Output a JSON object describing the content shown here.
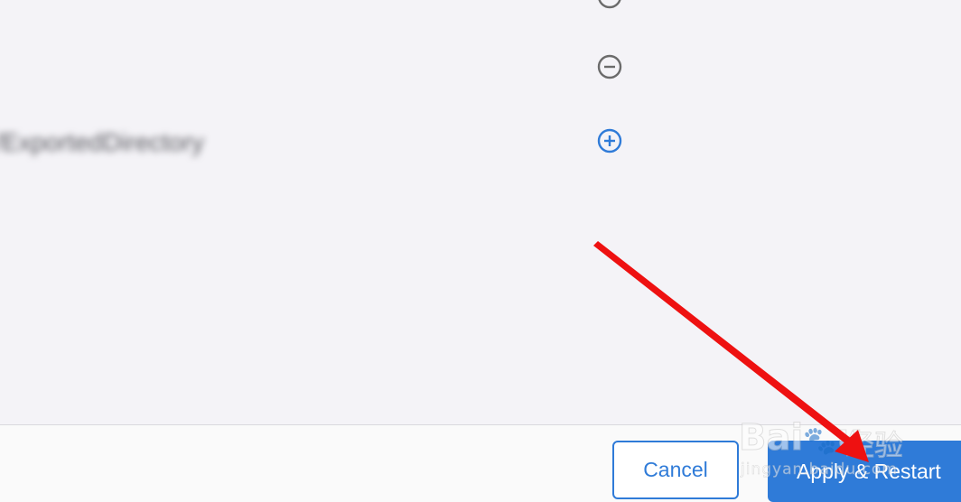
{
  "list": {
    "blurred_path": "/ExportedDirectory"
  },
  "icons": {
    "remove": "minus-circle-icon",
    "add": "plus-circle-icon"
  },
  "footer": {
    "cancel_label": "Cancel",
    "apply_label": "Apply & Restart"
  },
  "watermark": {
    "logo": "Baidu",
    "chinese": "经验",
    "url": "jingyan.baidu.com"
  },
  "colors": {
    "accent": "#2f7bd8",
    "background": "#f4f3f7",
    "footer_bg": "#fafafa",
    "icon_gray": "#6b6b6b",
    "annotation_arrow": "#ee1111"
  }
}
